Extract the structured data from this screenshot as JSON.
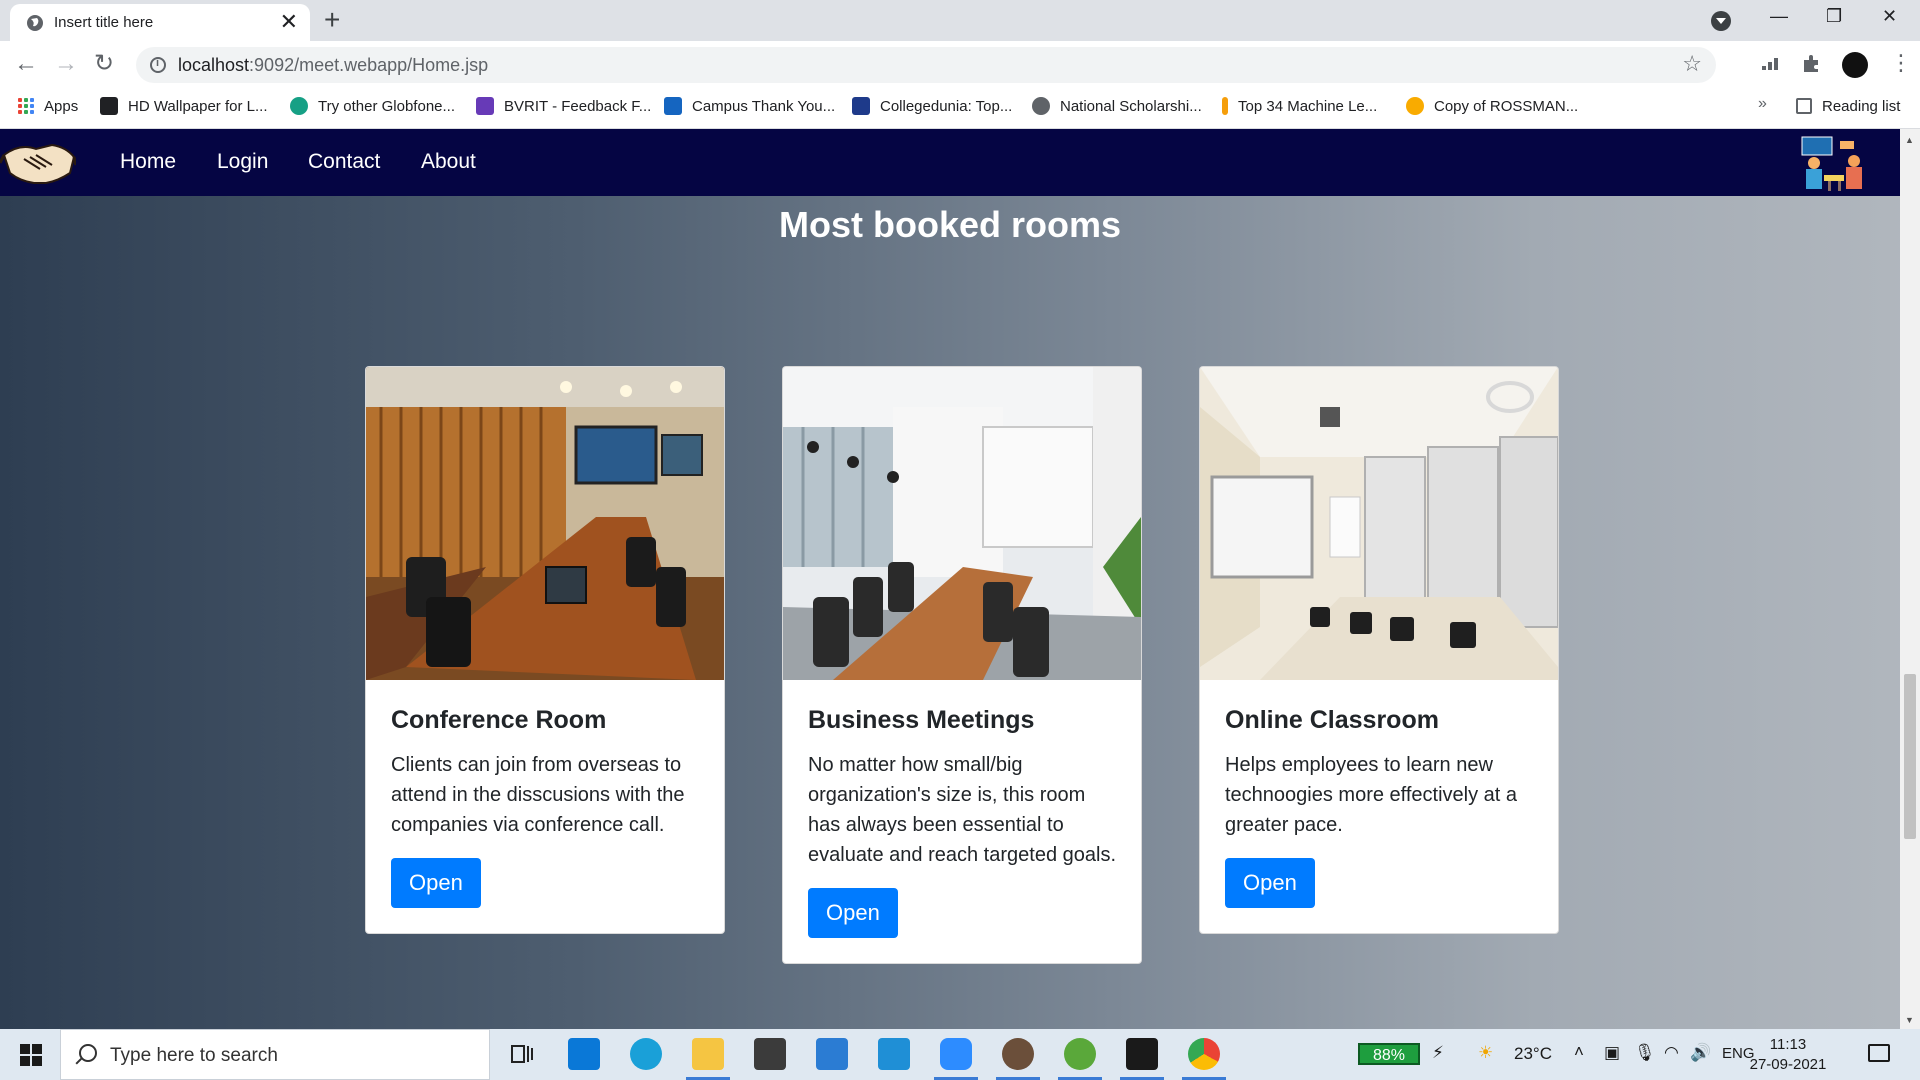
{
  "browser": {
    "tab_title": "Insert title here",
    "tab_close": "✕",
    "new_tab": "+",
    "url_host": "localhost",
    "url_path": ":9092/meet.webapp/Home.jsp",
    "window_controls": {
      "minimize": "—",
      "restore": "❐",
      "close": "✕"
    },
    "bookmarks": [
      {
        "label": "Apps",
        "icon": "apps-grid-icon"
      },
      {
        "label": "HD Wallpaper for L...",
        "icon": "image-icon",
        "color": "#202124"
      },
      {
        "label": "Try other Globfone...",
        "icon": "globfone-icon",
        "color": "#16a085"
      },
      {
        "label": "BVRIT - Feedback F...",
        "icon": "forms-icon",
        "color": "#673ab7"
      },
      {
        "label": "Campus Thank You...",
        "icon": "hi-icon",
        "color": "#1565c0"
      },
      {
        "label": "Collegedunia: Top...",
        "icon": "collegedunia-icon",
        "color": "#1e3a8a"
      },
      {
        "label": "National Scholarshi...",
        "icon": "globe-icon",
        "color": "#5f6368"
      },
      {
        "label": "Top 34 Machine Le...",
        "icon": "bars-icon",
        "color": "#f59e0b"
      },
      {
        "label": "Copy of ROSSMAN...",
        "icon": "colab-icon",
        "color": "#f9ab00"
      }
    ],
    "bookmarks_more": "»",
    "reading_list": "Reading list"
  },
  "navbar": {
    "links": [
      "Home",
      "Login",
      "Contact",
      "About"
    ]
  },
  "page": {
    "section_title": "Most booked rooms",
    "cards": [
      {
        "title": "Conference Room",
        "text": "Clients can join from overseas to attend in the disscusions with the companies via conference call.",
        "button": "Open"
      },
      {
        "title": "Business Meetings",
        "text": "No matter how small/big organization's size is, this room has always been essential to evaluate and reach targeted goals.",
        "button": "Open"
      },
      {
        "title": "Online Classroom",
        "text": "Helps employees to learn new technoogies more effectively at a greater pace.",
        "button": "Open"
      }
    ]
  },
  "taskbar": {
    "search_placeholder": "Type here to search",
    "battery": "88%",
    "temperature": "23°C",
    "language": "ENG",
    "time": "11:13",
    "date": "27-09-2021"
  }
}
